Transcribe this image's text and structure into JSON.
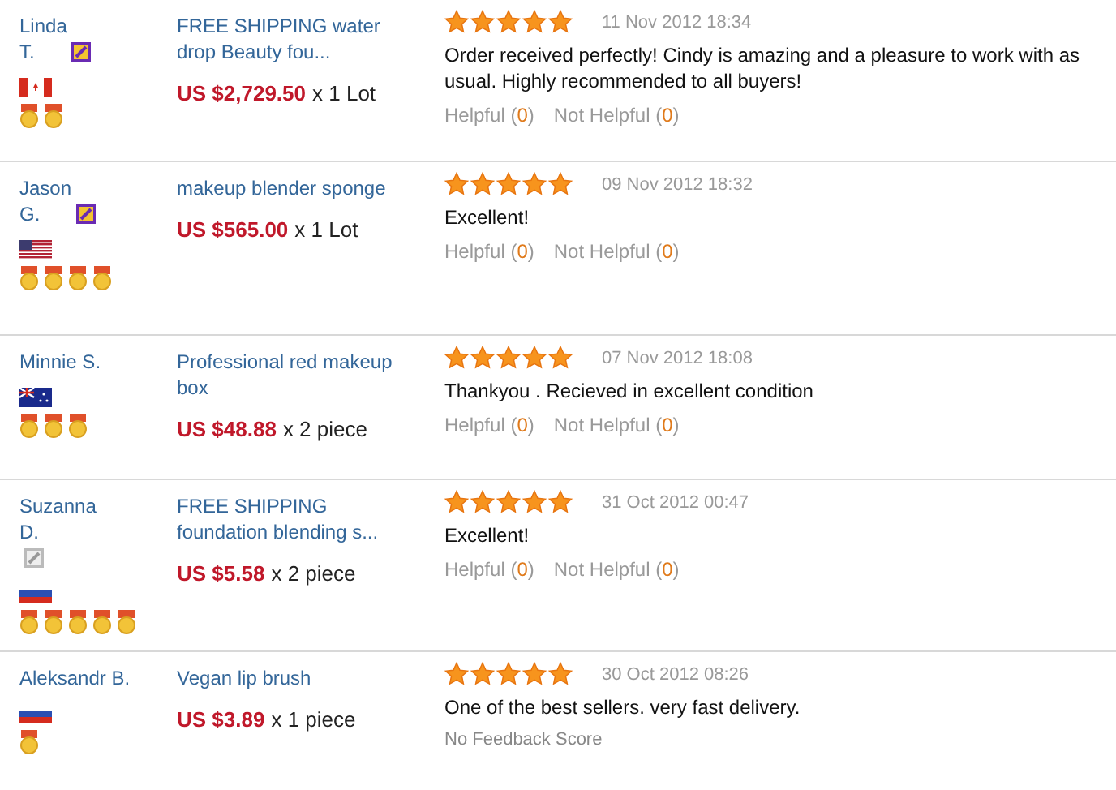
{
  "reviews": [
    {
      "buyer": "Linda T.",
      "verified": true,
      "flag": {
        "kind": "canada"
      },
      "medals": [
        {
          "kind": "medal"
        },
        {
          "kind": "medal"
        }
      ],
      "product": "FREE SHIPPING water drop Beauty fou...",
      "price": "US $2,729.50",
      "quantity": "x 1 Lot",
      "stars": 5,
      "date": "11 Nov 2012 18:34",
      "comment": "Order received perfectly! Cindy is amazing and a pleasure to work with as usual. Highly recommended to all buyers!",
      "helpful_label": "Helpful",
      "helpful_count": "(0)",
      "not_helpful_label": "Not Helpful",
      "not_helpful_count": "(0)"
    },
    {
      "buyer": "Jason G.",
      "verified": true,
      "flag": {
        "kind": "usa"
      },
      "medals": [
        {
          "kind": "medal"
        },
        {
          "kind": "medal"
        },
        {
          "kind": "medal"
        },
        {
          "kind": "medal"
        }
      ],
      "product": "makeup blender sponge",
      "price": "US $565.00",
      "quantity": "x 1 Lot",
      "stars": 5,
      "date": "09 Nov 2012 18:32",
      "comment": "Excellent!",
      "helpful_label": "Helpful",
      "helpful_count": "(0)",
      "not_helpful_label": "Not Helpful",
      "not_helpful_count": "(0)"
    },
    {
      "buyer": "Minnie S.",
      "flag": {
        "kind": "australia"
      },
      "medals": [
        {
          "kind": "medal"
        },
        {
          "kind": "medal"
        },
        {
          "kind": "medal"
        }
      ],
      "product": "Professional red makeup box",
      "price": "US $48.88",
      "quantity": "x 2 piece",
      "stars": 5,
      "date": "07 Nov 2012 18:08",
      "comment": "Thankyou . Recieved in excellent condition",
      "helpful_label": "Helpful",
      "helpful_count": "(0)",
      "not_helpful_label": "Not Helpful",
      "not_helpful_count": "(0)"
    },
    {
      "buyer": "Suzanna D.",
      "verified": false,
      "flag": {
        "kind": "russia"
      },
      "medals": [
        {
          "kind": "medal"
        },
        {
          "kind": "medal"
        },
        {
          "kind": "medal"
        },
        {
          "kind": "medal"
        },
        {
          "kind": "medal"
        }
      ],
      "product": "FREE SHIPPING foundation blending s...",
      "price": "US $5.58",
      "quantity": "x 2 piece",
      "stars": 5,
      "date": "31 Oct 2012 00:47",
      "comment": "Excellent!",
      "helpful_label": "Helpful",
      "helpful_count": "(0)",
      "not_helpful_label": "Not Helpful",
      "not_helpful_count": "(0)"
    },
    {
      "buyer": "Aleksandr B.",
      "flag": {
        "kind": "russia"
      },
      "medals": [
        {
          "kind": "medal"
        }
      ],
      "product": "Vegan lip brush",
      "price": "US $3.89",
      "quantity": "x 1 piece",
      "stars": 5,
      "date": "30 Oct 2012 08:26",
      "comment": "One of the best sellers. very fast delivery.",
      "feedback_note": "No Feedback Score"
    }
  ]
}
